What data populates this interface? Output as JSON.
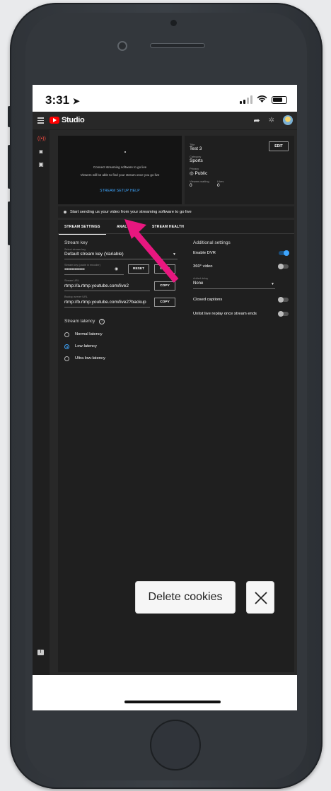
{
  "status_bar": {
    "time": "3:31"
  },
  "studio": {
    "logo_text": "Studio",
    "preview": {
      "line1": "Connect streaming software to go live",
      "line2": "Viewers will be able to find your stream once you go live",
      "setup_help": "STREAM SETUP HELP"
    },
    "info": {
      "title_label": "Title",
      "title": "Test 3",
      "category_label": "Category",
      "category": "Sports",
      "privacy_label": "Privacy",
      "privacy": "Public",
      "viewers_label": "Viewers waiting",
      "viewers": "0",
      "likes_label": "Likes",
      "likes": "0",
      "edit": "EDIT"
    },
    "message": "Start sending us your video from your streaming software to go live",
    "tabs": [
      "STREAM SETTINGS",
      "ANALY",
      "STREAM HEALTH"
    ],
    "stream_key": {
      "heading": "Stream key",
      "select_label": "Select stream key",
      "select_value": "Default stream key (Variable)",
      "key_label": "Stream key (paste in encoder)",
      "key_value": "••••••••••••••••",
      "reset": "RESET",
      "copy": "COPY",
      "url_label": "Stream URL",
      "url_value": "rtmp://a.rtmp.youtube.com/live2",
      "backup_label": "Backup server URL",
      "backup_value": "rtmp://b.rtmp.youtube.com/live2?backup"
    },
    "latency": {
      "heading": "Stream latency",
      "options": [
        "Normal latency",
        "Low-latency",
        "Ultra low-latency"
      ],
      "selected": "Low-latency"
    },
    "additional": {
      "heading": "Additional settings",
      "enable_dvr": "Enable DVR",
      "enable_dvr_on": true,
      "video_360": "360° video",
      "video_360_on": false,
      "delay_label": "Added delay",
      "delay_value": "None",
      "captions": "Closed captions",
      "captions_on": false,
      "unlist": "Unlist live replay once stream ends",
      "unlist_on": false
    }
  },
  "cookie_banner": {
    "delete": "Delete cookies",
    "close": "×"
  },
  "colors": {
    "annotation_arrow": "#e8177f",
    "accent": "#3ea6ff",
    "brand": "#ff0000"
  }
}
